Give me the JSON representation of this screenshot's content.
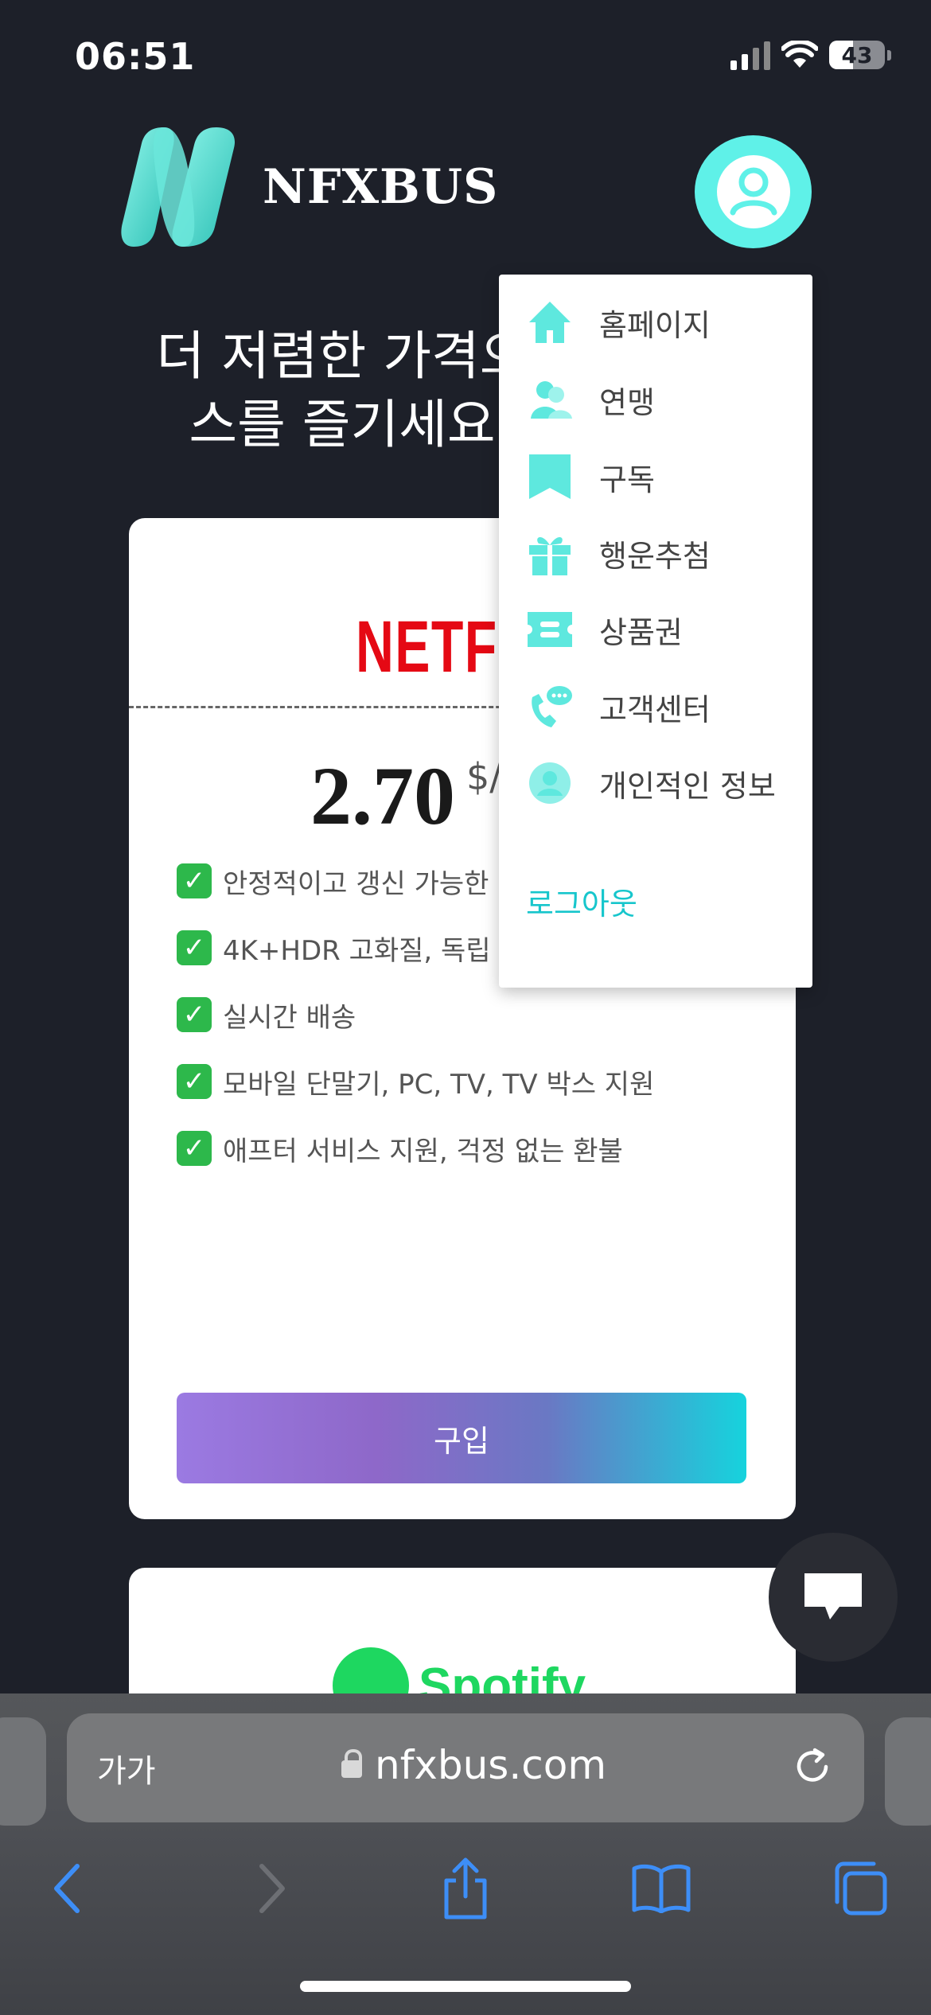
{
  "status_bar": {
    "time": "06:51",
    "battery": "43",
    "battery_level": 0.43,
    "signal_icon": "cellular-signal-icon",
    "wifi_icon": "wifi-icon"
  },
  "header": {
    "brand": "NFXBUS",
    "logo_icon": "nfxbus-logo",
    "account_icon": "user-circle-icon"
  },
  "hero": {
    "line1": "더 저렴한 가격으",
    "line2": "스를 즐기세요"
  },
  "product_card": {
    "logo_text": "NETFLIX",
    "price": "2.70",
    "unit": "$/",
    "features": [
      "안정적이고 갱신 가능한 ",
      "4K+HDR 고화질, 독립 ",
      "실시간 배송",
      "모바일 단말기, PC, TV, TV 박스 지원",
      "애프터 서비스 지원, 걱정 없는 환불"
    ],
    "buy_label": "구입"
  },
  "next_card": {
    "logo_text": "Spotify"
  },
  "menu": {
    "items": [
      {
        "label": "홈페이지",
        "icon": "home-icon"
      },
      {
        "label": "연맹",
        "icon": "users-icon"
      },
      {
        "label": "구독",
        "icon": "bookmark-icon"
      },
      {
        "label": "행운추첨",
        "icon": "gift-icon"
      },
      {
        "label": "상품권",
        "icon": "ticket-icon"
      },
      {
        "label": "고객센터",
        "icon": "support-phone-icon"
      },
      {
        "label": "개인적인 정보",
        "icon": "profile-icon"
      }
    ],
    "logout_label": "로그아웃"
  },
  "browser": {
    "aa_label": "가가",
    "url": "nfxbus.com",
    "colors": {
      "accent": "#5ff1e8",
      "link": "#17c6cc",
      "toolbar_icon": "#3d8ef7"
    }
  }
}
